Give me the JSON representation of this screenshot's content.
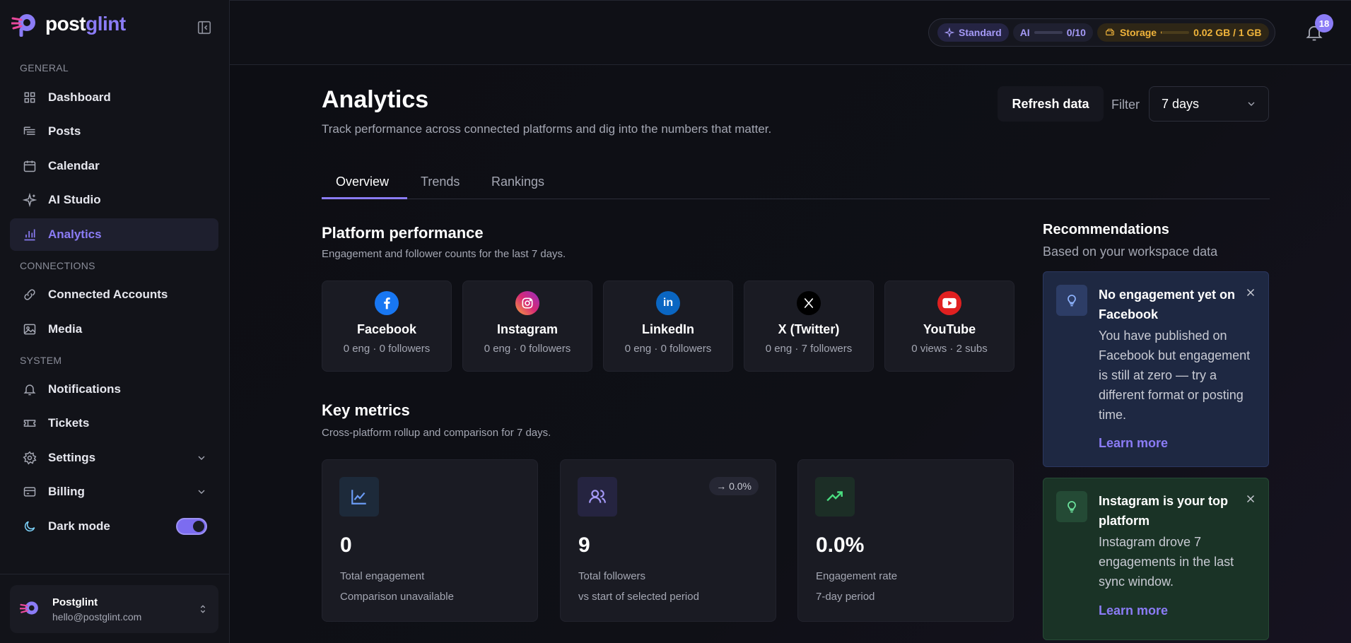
{
  "brand": {
    "name_part1": "post",
    "name_part2": "glint"
  },
  "sidebar": {
    "sections": [
      "GENERAL",
      "CONNECTIONS",
      "SYSTEM"
    ],
    "items": [
      {
        "label": "Dashboard",
        "icon": "grid-icon"
      },
      {
        "label": "Posts",
        "icon": "posts-icon"
      },
      {
        "label": "Calendar",
        "icon": "calendar-icon"
      },
      {
        "label": "AI Studio",
        "icon": "sparkle-icon"
      },
      {
        "label": "Analytics",
        "icon": "bar-chart-icon",
        "active": true
      },
      {
        "label": "Connected Accounts",
        "icon": "link-icon"
      },
      {
        "label": "Media",
        "icon": "image-icon"
      },
      {
        "label": "Notifications",
        "icon": "bell-icon"
      },
      {
        "label": "Tickets",
        "icon": "ticket-icon"
      },
      {
        "label": "Settings",
        "icon": "gear-icon"
      },
      {
        "label": "Billing",
        "icon": "card-icon"
      },
      {
        "label": "Dark mode",
        "icon": "moon-icon",
        "toggle_on": true
      }
    ],
    "user": {
      "name": "Postglint",
      "email": "hello@postglint.com"
    }
  },
  "topbar": {
    "plan": "Standard",
    "ai_label": "AI",
    "ai_usage": "0/10",
    "ai_fraction": 0.0,
    "storage_label": "Storage",
    "storage_usage": "0.02 GB / 1 GB",
    "storage_fraction": 0.02,
    "notifications_count": "18"
  },
  "page": {
    "title": "Analytics",
    "subtitle": "Track performance across connected platforms and dig into the numbers that matter.",
    "refresh_label": "Refresh data",
    "filter_label": "Filter",
    "filter_value": "7 days",
    "tabs": [
      "Overview",
      "Trends",
      "Rankings"
    ],
    "active_tab": "Overview"
  },
  "platform_performance": {
    "title": "Platform performance",
    "subtitle": "Engagement and follower counts for the last 7 days.",
    "platforms": [
      {
        "name": "Facebook",
        "stat": "0 eng · 0 followers",
        "color": "#1877f2",
        "glyph": "f"
      },
      {
        "name": "Instagram",
        "stat": "0 eng · 0 followers",
        "color": "#d62976",
        "glyph": "◎"
      },
      {
        "name": "LinkedIn",
        "stat": "0 eng · 0 followers",
        "color": "#0a66c2",
        "glyph": "in"
      },
      {
        "name": "X (Twitter)",
        "stat": "0 eng · 7 followers",
        "color": "#000000",
        "glyph": "𝕏"
      },
      {
        "name": "YouTube",
        "stat": "0 views · 2 subs",
        "color": "#ff0000",
        "glyph": "▶"
      }
    ]
  },
  "key_metrics": {
    "title": "Key metrics",
    "subtitle": "Cross-platform rollup and comparison for 7 days.",
    "cards": [
      {
        "value": "0",
        "label": "Total engagement",
        "sub": "Comparison unavailable",
        "icon": "line-chart-icon"
      },
      {
        "value": "9",
        "label": "Total followers",
        "sub": "vs start of selected period",
        "delta": "→ 0.0%",
        "icon": "users-icon"
      },
      {
        "value": "0.0%",
        "label": "Engagement rate",
        "sub": "7-day period",
        "icon": "trending-up-icon"
      }
    ]
  },
  "recommendations": {
    "title": "Recommendations",
    "subtitle": "Based on your workspace data",
    "items": [
      {
        "title": "No engagement yet on Facebook",
        "body": "You have published on Facebook but engagement is still at zero — try a different format or posting time.",
        "link": "Learn more"
      },
      {
        "title": "Instagram is your top platform",
        "body": "Instagram drove 7 engagements in the last sync window.",
        "link": "Learn more"
      }
    ]
  }
}
